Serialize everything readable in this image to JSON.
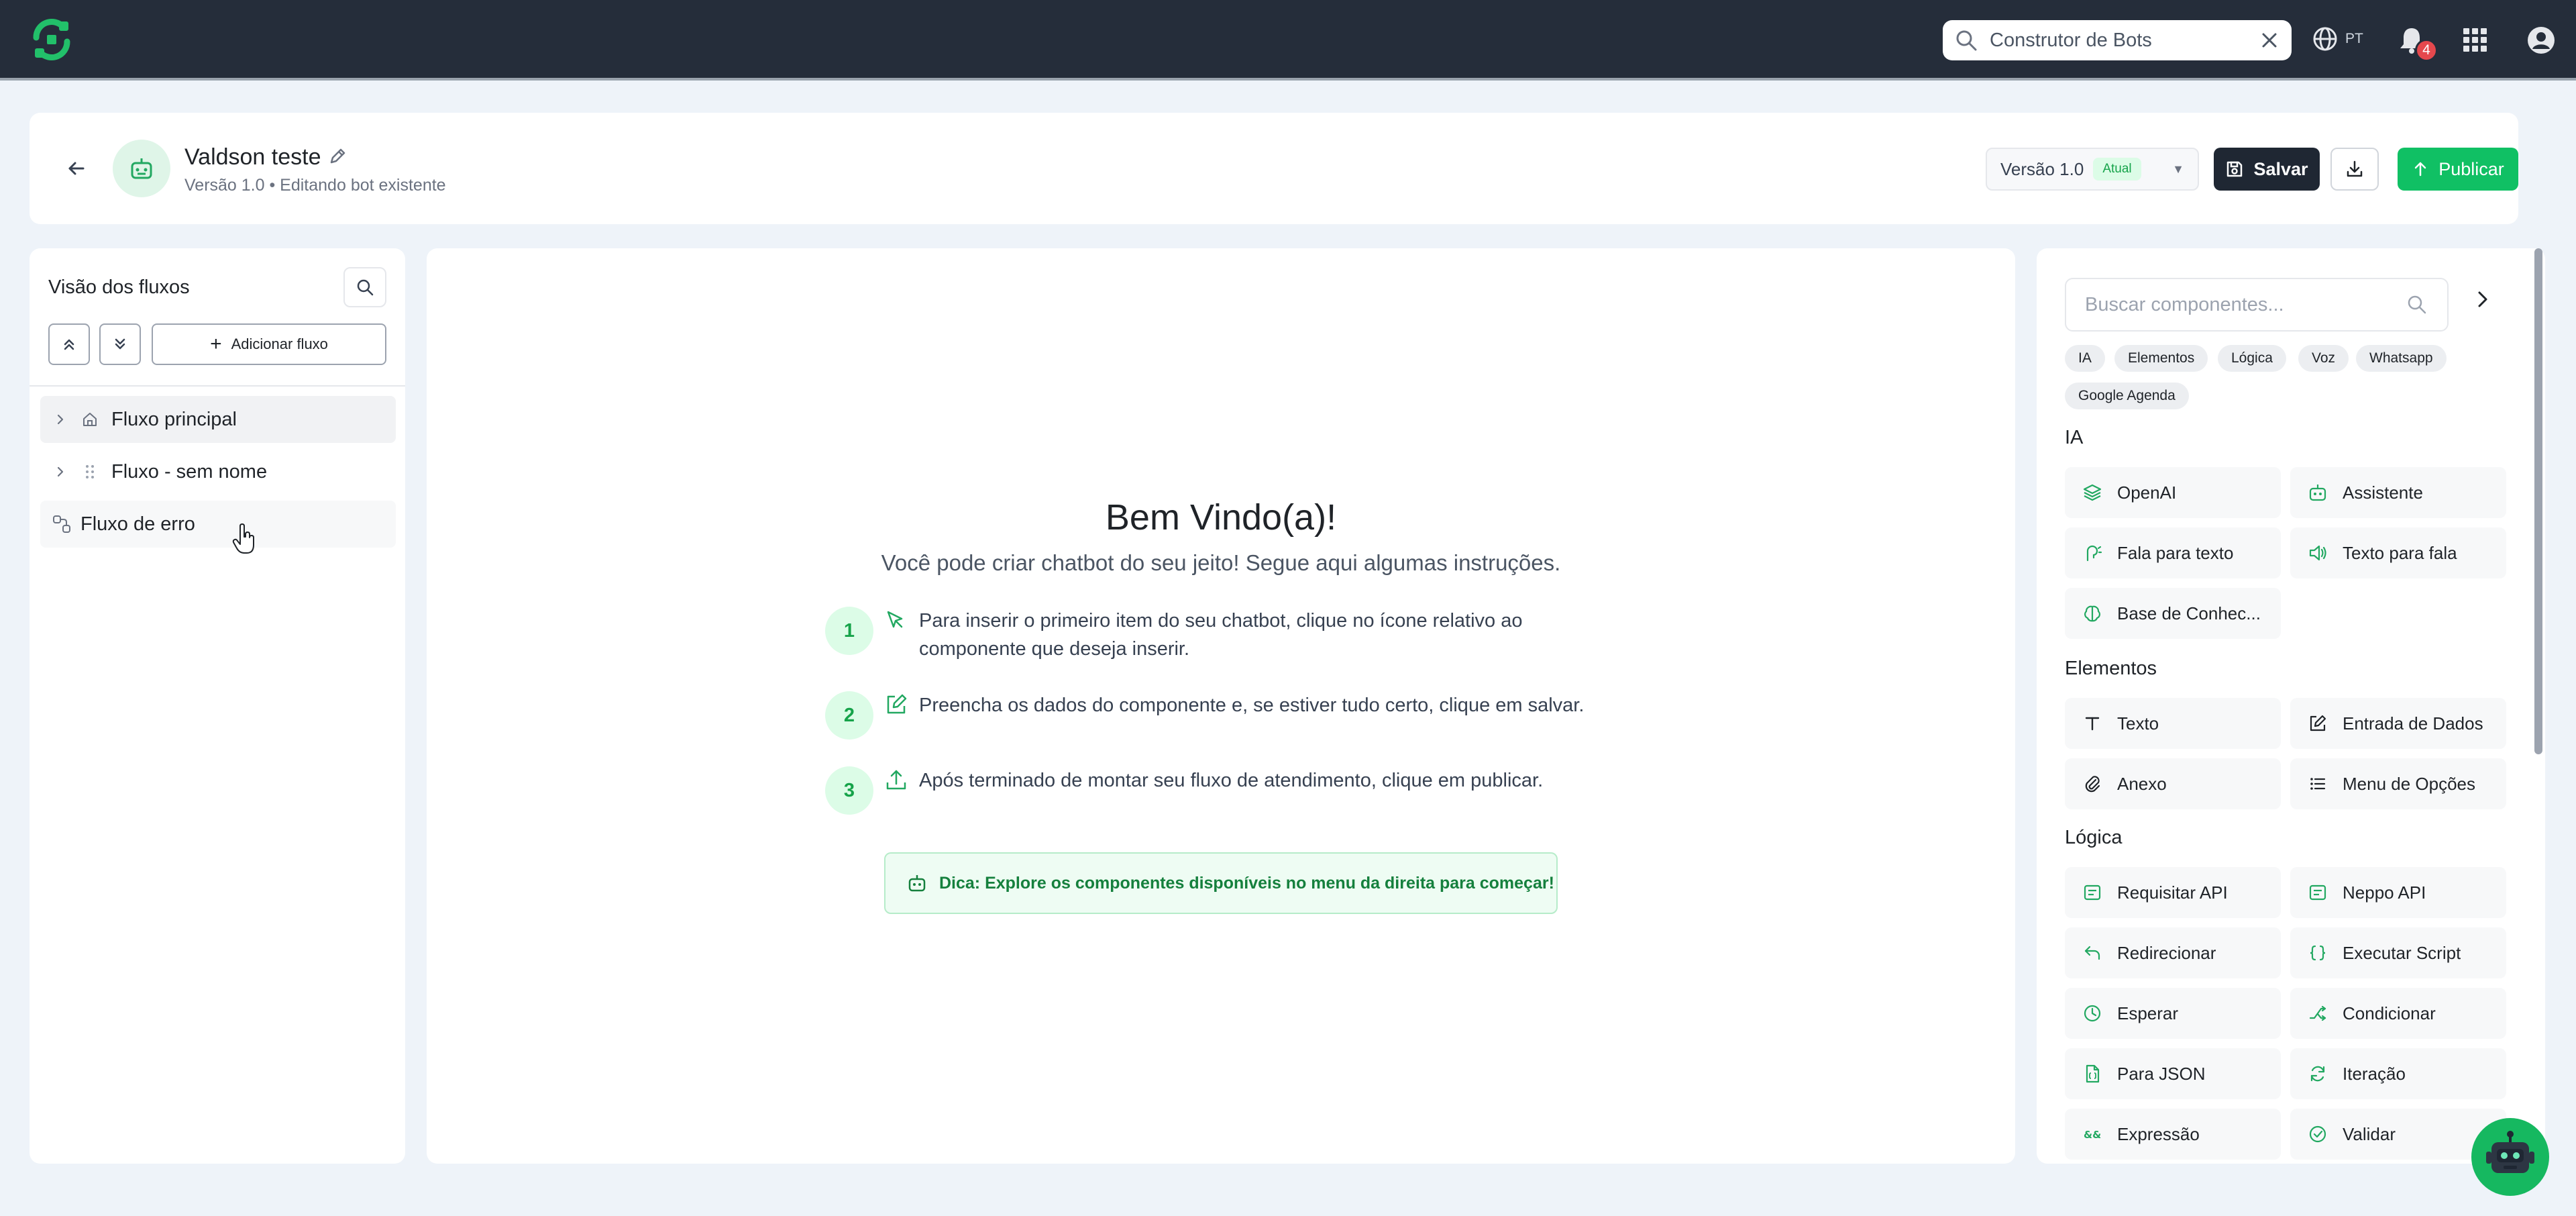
{
  "topbar": {
    "search_value": "Construtor de Bots",
    "language": "PT",
    "notifications_count": "4"
  },
  "header": {
    "bot_name": "Valdson teste",
    "subtitle": "Versão 1.0 • Editando bot existente",
    "version_label": "Versão 1.0",
    "version_badge": "Atual",
    "save_label": "Salvar",
    "publish_label": "Publicar"
  },
  "flows": {
    "title": "Visão dos fluxos",
    "add_label": "Adicionar fluxo",
    "items": [
      {
        "label": "Fluxo principal"
      },
      {
        "label": "Fluxo - sem nome"
      },
      {
        "label": "Fluxo de erro"
      }
    ]
  },
  "welcome": {
    "title": "Bem Vindo(a)!",
    "subtitle": "Você pode criar chatbot do seu jeito! Segue aqui algumas instruções.",
    "steps": [
      {
        "num": "1",
        "text": "Para inserir o primeiro item do seu chatbot, clique no ícone relativo ao componente que deseja inserir."
      },
      {
        "num": "2",
        "text": "Preencha os dados do componente e, se estiver tudo certo, clique em salvar."
      },
      {
        "num": "3",
        "text": "Após terminado de montar seu fluxo de atendimento, clique em publicar."
      }
    ],
    "tip": "Dica: Explore os componentes disponíveis no menu da direita para começar!"
  },
  "components": {
    "search_placeholder": "Buscar componentes...",
    "chips": [
      "IA",
      "Elementos",
      "Lógica",
      "Voz",
      "Whatsapp",
      "Google Agenda"
    ],
    "sections": [
      {
        "title": "IA",
        "items": [
          "OpenAI",
          "Assistente",
          "Fala para texto",
          "Texto para fala",
          "Base de Conhec..."
        ]
      },
      {
        "title": "Elementos",
        "items": [
          "Texto",
          "Entrada de Dados",
          "Anexo",
          "Menu de Opções"
        ]
      },
      {
        "title": "Lógica",
        "items": [
          "Requisitar API",
          "Neppo API",
          "Redirecionar",
          "Executar Script",
          "Esperar",
          "Condicionar",
          "Para JSON",
          "Iteração",
          "Expressão",
          "Validar"
        ]
      }
    ]
  },
  "colors": {
    "accent": "#10c064",
    "topbar": "#252d3a",
    "icon_green": "#22a861"
  }
}
